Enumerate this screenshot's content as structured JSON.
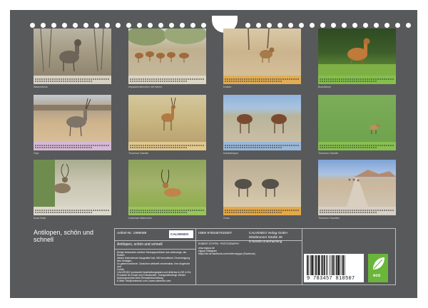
{
  "months": [
    {
      "caption": "Wasserbock"
    },
    {
      "caption": "Impalaherdenchen mit Harem"
    },
    {
      "caption": "Ducker"
    },
    {
      "caption": "Buschbock"
    },
    {
      "caption": "Oryx"
    },
    {
      "caption": "Thomson Gazelle"
    },
    {
      "caption": "Kuhantilopen"
    },
    {
      "caption": "Thomson Gazelle"
    },
    {
      "caption": "Kudu Bulle"
    },
    {
      "caption": "Letschwe Männchen"
    },
    {
      "caption": "Gnus"
    },
    {
      "caption": "Thomson Gazellen"
    }
  ],
  "back": {
    "title": "Antilopen, schön und schnell",
    "article_label": "Artikel-Nr: 1996089",
    "isbn": "ISBN 9783457810507",
    "publisher_name": "CALVENDO Verlag GmbH",
    "publisher_street": "Dittobrunner Straße 39",
    "publisher_city": "D-82008 Unterhaching",
    "logo_text": "CALVENDO",
    "product_title": "Antilopen, schön und schnell",
    "photographer": "ROBERT STYPPA · PHOTOGRAPHY",
    "contact_1": "www.styppa.de",
    "contact_2": "styppa Instagram",
    "contact_3": "https://de-de.facebook.com/robert.styppa (Facebook)",
    "desc_1": "Einige besonders schöne Schnappschüsse aus unterwegs, als Robert",
    "desc_2": "dieses Kalenderset fotografiert hat. Mit freundlicher Genehmigung des Verlages",
    "desc_3": "so gekennzeichnet. Zwischen weltweit verwendbar. Ihre Angebote und",
    "desc_4": "Grüße.",
    "desc_5": "CALVENDO produziert bearbeitungsstark und lieferbar in DE & EU.",
    "desc_6": "Produkte für Druck und Fotodrucker. Transportbedingt: Wörter",
    "desc_7": "Nutzungsrechte beim Einsatzbeschaffung.",
    "desc_8": "E-Mail: info@calvendo.com | www.calvendo.com",
    "barcode_digits": "9 783457 810507",
    "eco_label": "eco"
  }
}
